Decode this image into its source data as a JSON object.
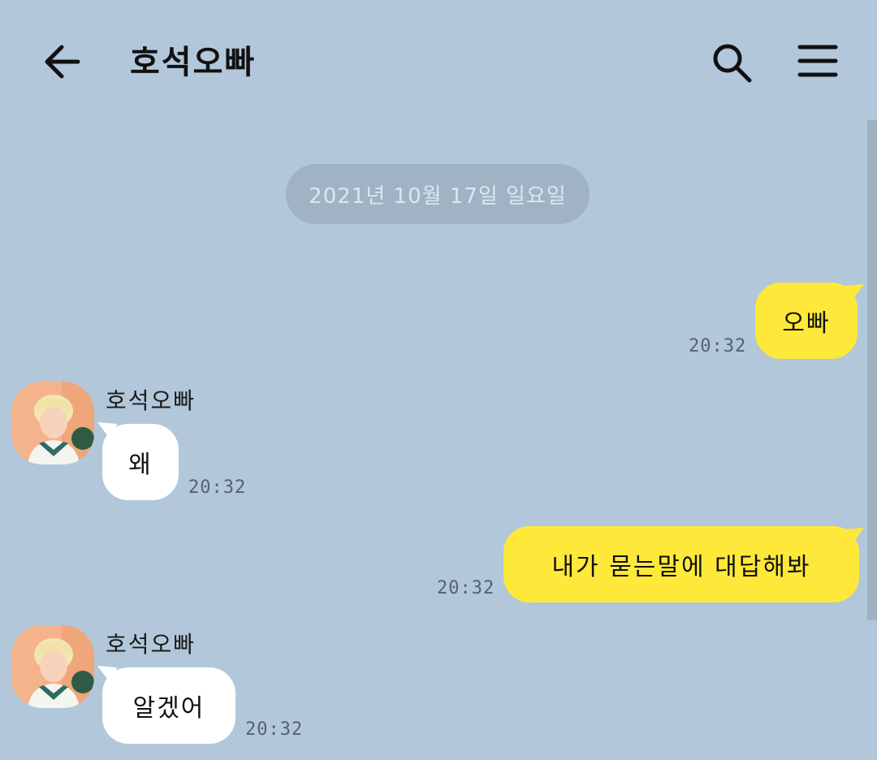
{
  "header": {
    "title": "호석오빠",
    "back_icon": "arrow-left-icon",
    "search_icon": "search-icon",
    "menu_icon": "menu-icon"
  },
  "date_divider": "2021년 10월 17일 일요일",
  "colors": {
    "background": "#b2c7da",
    "my_bubble": "#fee93a",
    "their_bubble": "#ffffff",
    "date_pill": "#9fb3c5"
  },
  "messages": [
    {
      "sender": "me",
      "text": "오빠",
      "time": "20:32"
    },
    {
      "sender": "호석오빠",
      "text": "왜",
      "time": "20:32"
    },
    {
      "sender": "me",
      "text": "내가 묻는말에 대답해봐",
      "time": "20:32"
    },
    {
      "sender": "호석오빠",
      "text": "알겠어",
      "time": "20:32"
    }
  ]
}
